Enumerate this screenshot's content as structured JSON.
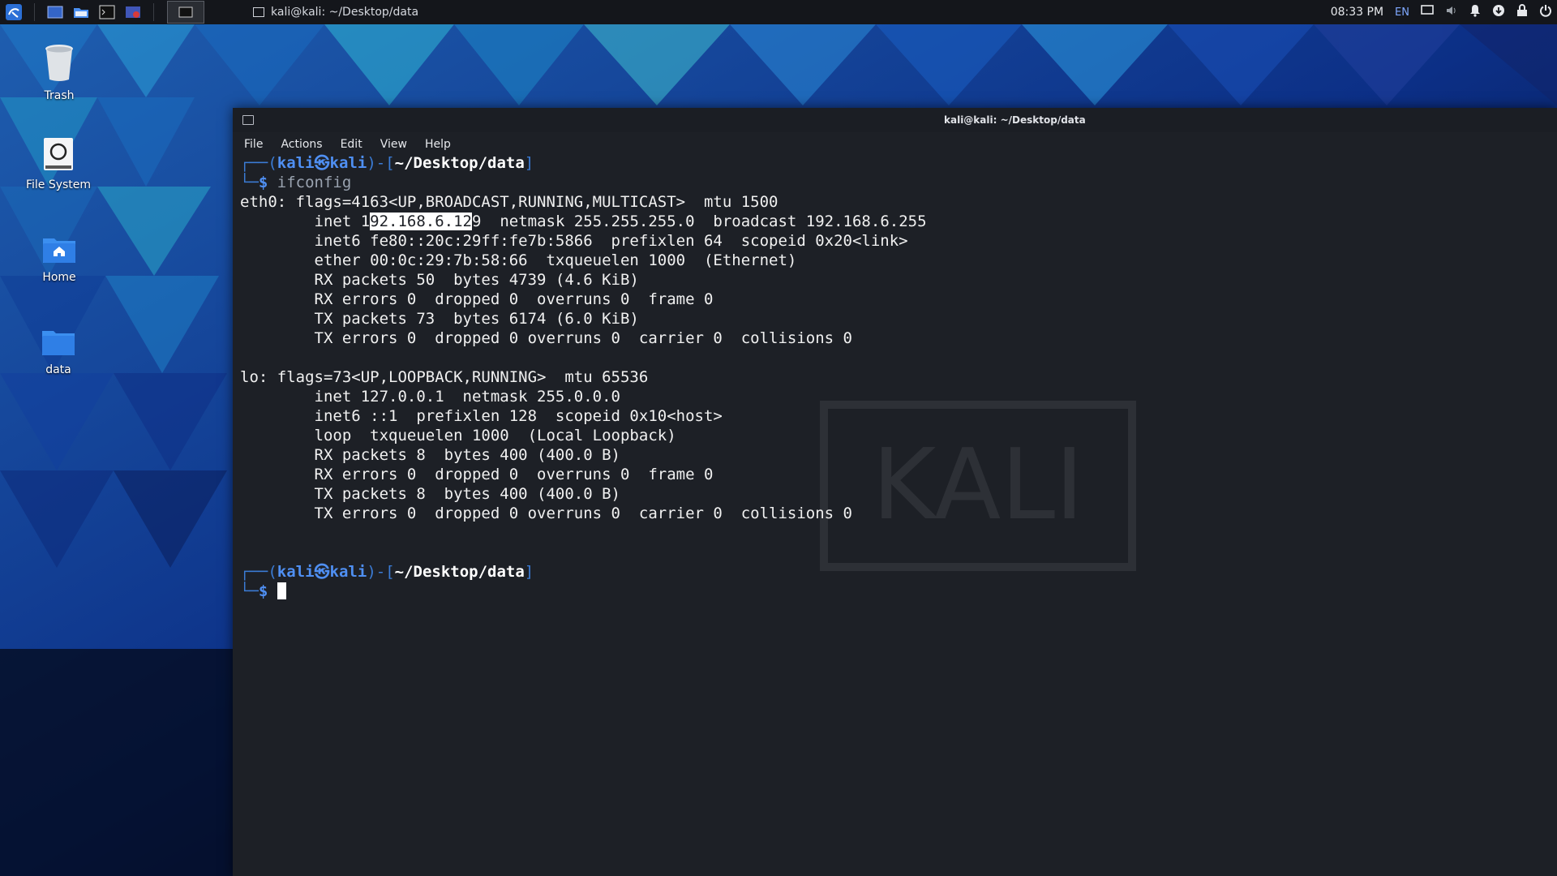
{
  "panel": {
    "window_title": "kali@kali: ~/Desktop/data",
    "clock": "08:33 PM",
    "lang": "EN"
  },
  "desktop": {
    "icons": [
      {
        "label": "Trash",
        "icon": "trash-icon"
      },
      {
        "label": "File System",
        "icon": "drive-icon"
      },
      {
        "label": "Home",
        "icon": "home-folder-icon"
      },
      {
        "label": "data",
        "icon": "folder-icon"
      }
    ]
  },
  "terminal": {
    "title": "kali@kali: ~/Desktop/data",
    "menu": [
      "File",
      "Actions",
      "Edit",
      "View",
      "Help"
    ],
    "prompt": {
      "open": "┌──(",
      "user": "kali",
      "at": "㉿",
      "host": "kali",
      "mid": ")-[",
      "path": "~/Desktop/data",
      "close": "]",
      "second": "└─",
      "dollar": "$"
    },
    "command": "ifconfig",
    "output": {
      "eth0_header": "eth0: flags=4163<UP,BROADCAST,RUNNING,MULTICAST>  mtu 1500",
      "eth0_inet_pre": "        inet 1",
      "eth0_inet_sel": "92.168.6.12",
      "eth0_inet_post": "9  netmask 255.255.255.0  broadcast 192.168.6.255",
      "eth0_lines": [
        "        inet6 fe80::20c:29ff:fe7b:5866  prefixlen 64  scopeid 0x20<link>",
        "        ether 00:0c:29:7b:58:66  txqueuelen 1000  (Ethernet)",
        "        RX packets 50  bytes 4739 (4.6 KiB)",
        "        RX errors 0  dropped 0  overruns 0  frame 0",
        "        TX packets 73  bytes 6174 (6.0 KiB)",
        "        TX errors 0  dropped 0 overruns 0  carrier 0  collisions 0"
      ],
      "lo_lines": [
        "lo: flags=73<UP,LOOPBACK,RUNNING>  mtu 65536",
        "        inet 127.0.0.1  netmask 255.0.0.0",
        "        inet6 ::1  prefixlen 128  scopeid 0x10<host>",
        "        loop  txqueuelen 1000  (Local Loopback)",
        "        RX packets 8  bytes 400 (400.0 B)",
        "        RX errors 0  dropped 0  overruns 0  frame 0",
        "        TX packets 8  bytes 400 (400.0 B)",
        "        TX errors 0  dropped 0 overruns 0  carrier 0  collisions 0"
      ]
    },
    "watermark": "KALI"
  }
}
